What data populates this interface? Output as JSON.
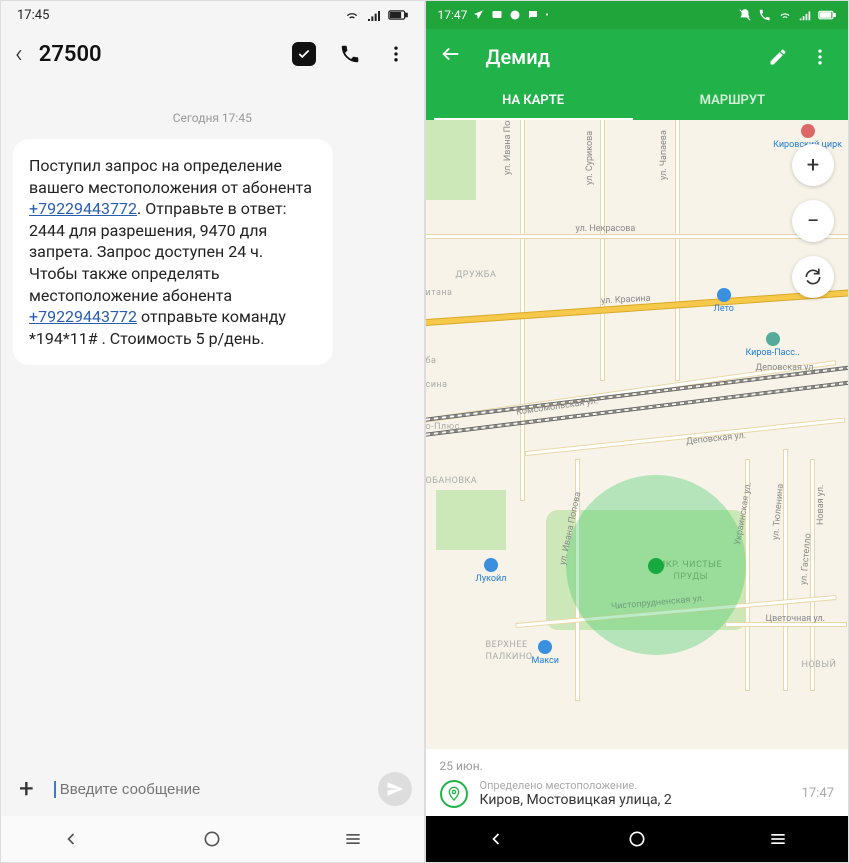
{
  "left": {
    "status": {
      "time": "17:45"
    },
    "header": {
      "title": "27500"
    },
    "conversation_timestamp": "Сегодня 17:45",
    "message": {
      "part1": "Поступил запрос на определение вашего местоположения от абонента ",
      "phone1": "+79229443772",
      "part2": ". Отправьте в ответ: 2444 для разрешения, 9470 для запрета. Запрос доступен 24 ч.",
      "part3": "Чтобы также определять местоположение абонента ",
      "phone2": "+79229443772",
      "part4": " отправьте команду *194*11# . Стоимость 5 р/день."
    },
    "composer": {
      "placeholder": "Введите сообщение"
    }
  },
  "right": {
    "status": {
      "time": "17:47"
    },
    "header": {
      "title": "Демид"
    },
    "tabs": {
      "map": "НА КАРТЕ",
      "route": "МАРШРУТ"
    },
    "map": {
      "streets": {
        "nekrasova": "ул. Некрасова",
        "krasina": "ул. Красина",
        "komsomolskaya": "Комсомольская ул.",
        "depovskaya": "Деповская ул.",
        "depovskaya2": "Деповская ул.",
        "chistoprud": "Чистопрудненская ул.",
        "cvetochnaya": "Цветочная ул.",
        "ivana_popova": "ул. Ивана Попова",
        "ivana_popova2": "ул. Ивана Попова",
        "surikova": "ул. Сурикова",
        "chapaeva": "ул. Чапаева",
        "ukrainskaya": "Украинская ул.",
        "tyulenina": "ул. Тюленина",
        "gastello": "ул. Гастелло",
        "novaya": "Новая ул."
      },
      "districts": {
        "druzhba": "ДРУЖБА",
        "itana": "итана",
        "ba": "ба",
        "sina": "сина",
        "plus": "о-Плюс",
        "obanovka": "ОБАНОВКА",
        "chistye_prudy_1": "МКР. ЧИСТЫЕ",
        "chistye_prudy_2": "ПРУДЫ",
        "palkino_1": "ВЕРХНЕЕ",
        "palkino_2": "ПАЛКИНО",
        "novyj": "НОВЫЙ"
      },
      "poi": {
        "circus": "Кировский цирк",
        "leto": "Лето",
        "kirov_pass": "Киров-Пасс..",
        "lukoil": "Лукойл",
        "maxi": "Макси"
      }
    },
    "bottom": {
      "date": "25 июн.",
      "sub": "Определено местоположение.",
      "address": "Киров, Мостовицкая улица, 2",
      "time": "17:47"
    }
  }
}
